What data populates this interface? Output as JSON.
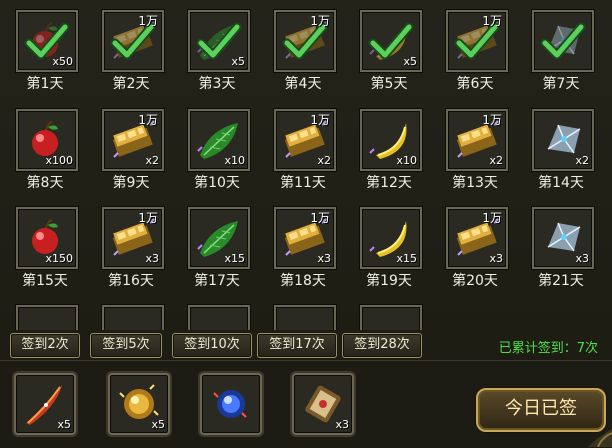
{
  "days": [
    {
      "label": "第1天",
      "item": "apple",
      "qty": "x50",
      "wan": "",
      "claimed": true
    },
    {
      "label": "第2天",
      "item": "gold",
      "qty": "",
      "wan": "1万",
      "claimed": true
    },
    {
      "label": "第3天",
      "item": "leaf",
      "qty": "x5",
      "wan": "",
      "claimed": true
    },
    {
      "label": "第4天",
      "item": "gold",
      "qty": "",
      "wan": "1万",
      "claimed": true
    },
    {
      "label": "第5天",
      "item": "banana",
      "qty": "x5",
      "wan": "",
      "claimed": true
    },
    {
      "label": "第6天",
      "item": "gold",
      "qty": "",
      "wan": "1万",
      "claimed": true
    },
    {
      "label": "第7天",
      "item": "crystal",
      "qty": "",
      "wan": "",
      "claimed": true
    },
    {
      "label": "第8天",
      "item": "apple",
      "qty": "x100",
      "wan": "",
      "claimed": false
    },
    {
      "label": "第9天",
      "item": "gold",
      "qty": "x2",
      "wan": "1万",
      "claimed": false
    },
    {
      "label": "第10天",
      "item": "leaf",
      "qty": "x10",
      "wan": "",
      "claimed": false
    },
    {
      "label": "第11天",
      "item": "gold",
      "qty": "x2",
      "wan": "1万",
      "claimed": false
    },
    {
      "label": "第12天",
      "item": "banana",
      "qty": "x10",
      "wan": "",
      "claimed": false
    },
    {
      "label": "第13天",
      "item": "gold",
      "qty": "x2",
      "wan": "1万",
      "claimed": false
    },
    {
      "label": "第14天",
      "item": "crystal",
      "qty": "x2",
      "wan": "",
      "claimed": false
    },
    {
      "label": "第15天",
      "item": "apple",
      "qty": "x150",
      "wan": "",
      "claimed": false
    },
    {
      "label": "第16天",
      "item": "gold",
      "qty": "x3",
      "wan": "1万",
      "claimed": false
    },
    {
      "label": "第17天",
      "item": "leaf",
      "qty": "x15",
      "wan": "",
      "claimed": false
    },
    {
      "label": "第18天",
      "item": "gold",
      "qty": "x3",
      "wan": "1万",
      "claimed": false
    },
    {
      "label": "第19天",
      "item": "banana",
      "qty": "x15",
      "wan": "",
      "claimed": false
    },
    {
      "label": "第20天",
      "item": "gold",
      "qty": "x3",
      "wan": "1万",
      "claimed": false
    },
    {
      "label": "第21天",
      "item": "crystal",
      "qty": "x3",
      "wan": "",
      "claimed": false
    }
  ],
  "milestones": [
    "签到2次",
    "签到5次",
    "签到10次",
    "签到17次",
    "签到28次"
  ],
  "cumulative": "已累计签到：7次",
  "rewards": [
    {
      "item": "feather",
      "qty": "x5"
    },
    {
      "item": "orb-gold",
      "qty": "x5"
    },
    {
      "item": "orb-blue",
      "qty": ""
    },
    {
      "item": "scroll",
      "qty": "x3"
    }
  ],
  "sign_button": "今日已签",
  "colors": {
    "accent": "#4fe04a",
    "check": "#5cd05c",
    "border": "#6a6756",
    "button_border": "#c9a85a"
  }
}
